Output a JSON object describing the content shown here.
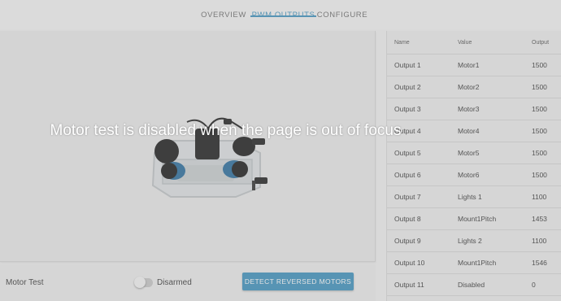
{
  "tabs": [
    {
      "label": "OVERVIEW",
      "active": false
    },
    {
      "label": "PWM OUTPUTS",
      "active": true
    },
    {
      "label": "CONFIGURE",
      "active": false
    }
  ],
  "motor_test": {
    "label": "Motor Test",
    "switch_state": "Disarmed",
    "detect_button": "DETECT REVERSED MOTORS"
  },
  "table": {
    "headers": {
      "name": "Name",
      "value": "Value",
      "output": "Output"
    },
    "rows": [
      {
        "name": "Output 1",
        "value": "Motor1",
        "output": "1500"
      },
      {
        "name": "Output 2",
        "value": "Motor2",
        "output": "1500"
      },
      {
        "name": "Output 3",
        "value": "Motor3",
        "output": "1500"
      },
      {
        "name": "Output 4",
        "value": "Motor4",
        "output": "1500"
      },
      {
        "name": "Output 5",
        "value": "Motor5",
        "output": "1500"
      },
      {
        "name": "Output 6",
        "value": "Motor6",
        "output": "1500"
      },
      {
        "name": "Output 7",
        "value": "Lights 1",
        "output": "1100"
      },
      {
        "name": "Output 8",
        "value": "Mount1Pitch",
        "output": "1453"
      },
      {
        "name": "Output 9",
        "value": "Lights 2",
        "output": "1100"
      },
      {
        "name": "Output 10",
        "value": "Mount1Pitch",
        "output": "1546"
      },
      {
        "name": "Output 11",
        "value": "Disabled",
        "output": "0"
      }
    ]
  },
  "overlay": {
    "message": "Motor test is disabled when the page is out of focus"
  },
  "colors": {
    "accent": "#3f93c0",
    "background": "#f3f3f3",
    "overlay": "rgba(150,150,150,0.28)"
  }
}
